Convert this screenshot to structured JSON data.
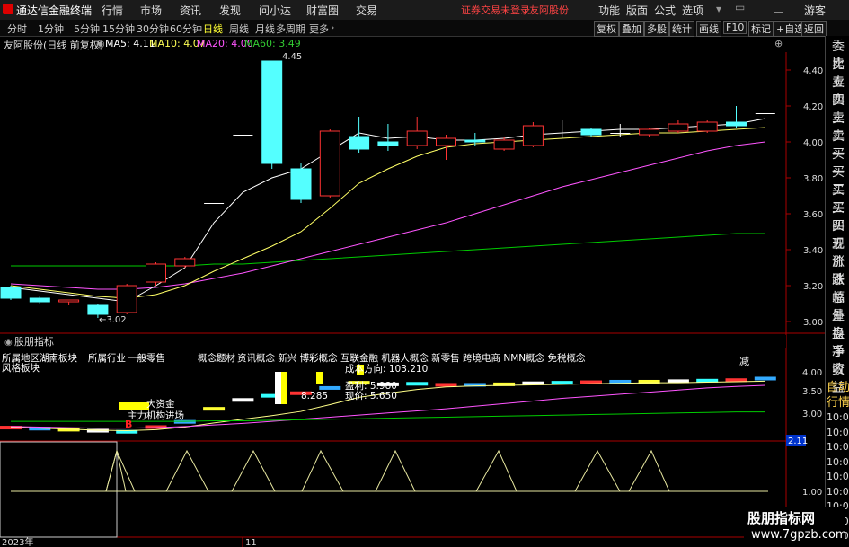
{
  "titlebar": {
    "app_name": "通达信金融终端",
    "menus": [
      "行情",
      "市场",
      "资讯",
      "发现",
      "问小达",
      "财富圈",
      "交易"
    ],
    "warning": "证券交易未登录",
    "broker": "友阿股份",
    "right_menus": [
      "功能",
      "版面",
      "公式",
      "选项"
    ],
    "user": "游客"
  },
  "toolbar": {
    "periods": [
      "分时",
      "1分钟",
      "5分钟",
      "15分钟",
      "30分钟",
      "60分钟",
      "日线",
      "周线",
      "月线",
      "多周期",
      "更多"
    ],
    "active_period": "日线",
    "right_buttons": [
      "复权",
      "叠加",
      "多股",
      "统计",
      "画线",
      "F10",
      "标记",
      "+自选",
      "返回"
    ]
  },
  "info": {
    "stock": "友阿股份(日线 前复权)",
    "ma5": "MA5: 4.11",
    "ma10": "MA10: 4.07",
    "ma20": "MA20: 4.00",
    "ma60": "MA60: 3.49"
  },
  "colors": {
    "up": "#ff3333",
    "down": "#54ffff",
    "ma5": "#ffffff",
    "ma10": "#ffff55",
    "ma20": "#ff55ff",
    "ma60": "#00cc00",
    "axis": "#aa0000"
  },
  "price_axis": [
    "4.40",
    "4.20",
    "4.00",
    "3.80",
    "3.60",
    "3.40",
    "3.20",
    "3.00"
  ],
  "annotations": {
    "high": "4.45",
    "low": "3.02"
  },
  "indicator": {
    "title": "股朋指标",
    "region": "所属地区",
    "region_value": "湖南板块",
    "style": "风格板块",
    "industry": "所属行业",
    "industry_value": "一般零售",
    "concepts_label": "概念题材",
    "concepts": "资讯概念 新兴 博彩概念 互联金融 机器人概念 新零售 跨境电商 NMN概念 免税概念",
    "line1": "8.285",
    "direction": "成本方向: 103.210",
    "profit": "盈利: 5.980",
    "price_now": "现价: 5.650",
    "tag_big": "大资金",
    "tag_enter": "主力机构进场",
    "letter_b": "B",
    "letter_top": "减",
    "axis": [
      "4.00",
      "3.50",
      "3.00"
    ],
    "value_box": "2.11",
    "axis_low": "1.00"
  },
  "right_panel": [
    "委比",
    "卖五",
    "卖四",
    "卖三",
    "卖二",
    "卖一",
    "买一",
    "买二",
    "买三",
    "买四",
    "买五",
    "现价",
    "涨跌",
    "涨幅",
    "总量",
    "外盘",
    "换手",
    "净资",
    "收益"
  ],
  "right_panel2": [
    "自动",
    "行情",
    "10:03",
    "10:03",
    "10:03",
    "10:03",
    "10:03",
    "10:03",
    "10:03",
    "10:03",
    "10:03"
  ],
  "date_labels": [
    "2023年",
    "11"
  ],
  "watermark": {
    "line1": "股朋指标网",
    "line2": "www.7gpzb.com"
  },
  "chart_data": {
    "type": "candlestick",
    "y_range": [
      2.95,
      4.5
    ],
    "candles": [
      {
        "o": 3.19,
        "c": 3.13,
        "h": 3.2,
        "l": 3.12
      },
      {
        "o": 3.13,
        "c": 3.11,
        "h": 3.14,
        "l": 3.1
      },
      {
        "o": 3.11,
        "c": 3.12,
        "h": 3.12,
        "l": 3.09
      },
      {
        "o": 3.09,
        "c": 3.04,
        "h": 3.1,
        "l": 3.02
      },
      {
        "o": 3.05,
        "c": 3.2,
        "h": 3.21,
        "l": 3.04
      },
      {
        "o": 3.22,
        "c": 3.32,
        "h": 3.33,
        "l": 3.2
      },
      {
        "o": 3.31,
        "c": 3.35,
        "h": 3.36,
        "l": 3.3
      },
      {
        "o": 3.66,
        "c": 3.66,
        "h": 3.66,
        "l": 3.66
      },
      {
        "o": 4.04,
        "c": 4.04,
        "h": 4.04,
        "l": 4.04
      },
      {
        "o": 4.45,
        "c": 3.88,
        "h": 4.45,
        "l": 3.85
      },
      {
        "o": 3.85,
        "c": 3.68,
        "h": 3.88,
        "l": 3.66
      },
      {
        "o": 3.7,
        "c": 4.06,
        "h": 4.07,
        "l": 3.69
      },
      {
        "o": 4.03,
        "c": 3.96,
        "h": 4.14,
        "l": 3.94
      },
      {
        "o": 4.0,
        "c": 3.98,
        "h": 4.1,
        "l": 3.95
      },
      {
        "o": 3.98,
        "c": 4.06,
        "h": 4.14,
        "l": 3.96
      },
      {
        "o": 3.98,
        "c": 4.02,
        "h": 4.04,
        "l": 3.9
      },
      {
        "o": 4.01,
        "c": 4.0,
        "h": 4.05,
        "l": 3.98
      },
      {
        "o": 3.96,
        "c": 4.01,
        "h": 4.03,
        "l": 3.95
      },
      {
        "o": 3.98,
        "c": 4.09,
        "h": 4.11,
        "l": 3.97
      },
      {
        "o": 4.08,
        "c": 4.08,
        "h": 4.12,
        "l": 4.02
      },
      {
        "o": 4.07,
        "c": 4.04,
        "h": 4.08,
        "l": 4.03
      },
      {
        "o": 4.05,
        "c": 4.05,
        "h": 4.1,
        "l": 4.03
      },
      {
        "o": 4.04,
        "c": 4.07,
        "h": 4.08,
        "l": 4.03
      },
      {
        "o": 4.06,
        "c": 4.1,
        "h": 4.12,
        "l": 4.05
      },
      {
        "o": 4.06,
        "c": 4.11,
        "h": 4.12,
        "l": 4.05
      },
      {
        "o": 4.11,
        "c": 4.09,
        "h": 4.2,
        "l": 4.08
      },
      {
        "o": 4.16,
        "c": 4.16,
        "h": 4.16,
        "l": 4.16
      }
    ],
    "ma5": [
      3.19,
      3.17,
      3.15,
      3.13,
      3.11,
      3.2,
      3.3,
      3.55,
      3.72,
      3.8,
      3.85,
      3.95,
      4.05,
      4.02,
      4.03,
      4.01,
      4.01,
      4.02,
      4.04,
      4.05,
      4.06,
      4.07,
      4.07,
      4.08,
      4.09,
      4.1,
      4.13
    ],
    "ma10": [
      3.2,
      3.18,
      3.16,
      3.14,
      3.13,
      3.15,
      3.2,
      3.28,
      3.35,
      3.42,
      3.5,
      3.63,
      3.77,
      3.85,
      3.92,
      3.97,
      3.99,
      4.0,
      4.01,
      4.02,
      4.03,
      4.04,
      4.05,
      4.05,
      4.06,
      4.07,
      4.08
    ],
    "ma20": [
      3.21,
      3.2,
      3.19,
      3.18,
      3.18,
      3.19,
      3.21,
      3.24,
      3.27,
      3.31,
      3.35,
      3.39,
      3.43,
      3.47,
      3.51,
      3.55,
      3.6,
      3.65,
      3.7,
      3.75,
      3.79,
      3.83,
      3.87,
      3.91,
      3.95,
      3.98,
      4.0
    ],
    "ma60": [
      3.31,
      3.31,
      3.31,
      3.31,
      3.31,
      3.31,
      3.31,
      3.32,
      3.32,
      3.33,
      3.34,
      3.35,
      3.36,
      3.37,
      3.38,
      3.39,
      3.4,
      3.41,
      3.42,
      3.43,
      3.44,
      3.45,
      3.46,
      3.47,
      3.48,
      3.49,
      3.49
    ]
  }
}
